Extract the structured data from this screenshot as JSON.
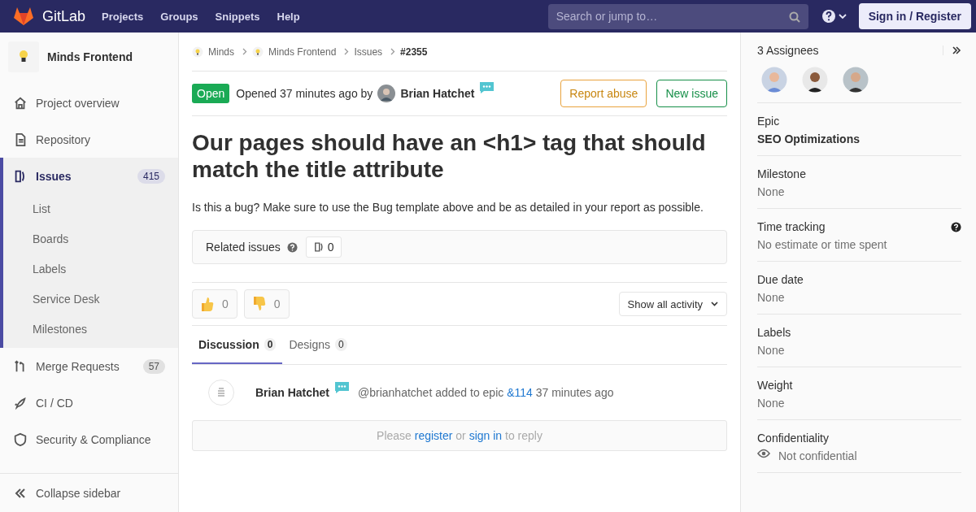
{
  "topbar": {
    "brand": "GitLab",
    "nav": [
      "Projects",
      "Groups",
      "Snippets",
      "Help"
    ],
    "search": {
      "placeholder": "Search or jump to…"
    },
    "sign_in": "Sign in / Register"
  },
  "sidebar": {
    "project": "Minds Frontend",
    "items": [
      {
        "label": "Project overview",
        "selected": false
      },
      {
        "label": "Repository",
        "selected": false
      },
      {
        "label": "Issues",
        "selected": true,
        "count": "415",
        "children": [
          {
            "label": "List"
          },
          {
            "label": "Boards"
          },
          {
            "label": "Labels"
          },
          {
            "label": "Service Desk"
          },
          {
            "label": "Milestones"
          }
        ]
      },
      {
        "label": "Merge Requests",
        "selected": false,
        "count": "57"
      },
      {
        "label": "CI / CD",
        "selected": false
      },
      {
        "label": "Security & Compliance",
        "selected": false
      }
    ],
    "collapse": "Collapse sidebar"
  },
  "breadcrumbs": [
    "Minds",
    "Minds Frontend",
    "Issues",
    "#2355"
  ],
  "issue": {
    "status": "Open",
    "opened": "Opened 37 minutes ago by",
    "author": "Brian Hatchet",
    "buttons": [
      {
        "label": "Report abuse",
        "kind": "warning"
      },
      {
        "label": "New issue",
        "kind": "success"
      }
    ],
    "title": "Our pages should have an <h1> tag that should match the title attribute",
    "description": "Is this a bug? Make sure to use the Bug template above and be as detailed in your report as possible.",
    "related": {
      "label": "Related issues",
      "count": "0"
    },
    "reactions": [
      {
        "kind": "up",
        "count": "0"
      },
      {
        "kind": "down",
        "count": "0"
      }
    ],
    "activity": "Show all activity",
    "tabs": [
      {
        "label": "Discussion",
        "count": "0",
        "selected": true
      },
      {
        "label": "Designs",
        "count": "0",
        "selected": false
      }
    ],
    "note": {
      "author": "Brian Hatchet",
      "text": "@brianhatchet added to epic",
      "link": "&114",
      "time": "37 minutes ago"
    },
    "reply": {
      "before": "Please",
      "link1": "register",
      "mid": "or",
      "link2": "sign in",
      "after": "to reply"
    }
  },
  "right": {
    "assignees": "3 Assignees",
    "sections": [
      {
        "kind": "epic",
        "label": "Epic",
        "value": "SEO Optimizations"
      },
      {
        "kind": "text",
        "label": "Milestone",
        "value": "None"
      },
      {
        "kind": "help",
        "label": "Time tracking",
        "value": "No estimate or time spent"
      },
      {
        "kind": "text",
        "label": "Due date",
        "value": "None"
      },
      {
        "kind": "text",
        "label": "Labels",
        "value": "None"
      },
      {
        "kind": "text",
        "label": "Weight",
        "value": "None"
      },
      {
        "kind": "visibility",
        "label": "Confidentiality",
        "value": "Not confidential"
      }
    ]
  }
}
